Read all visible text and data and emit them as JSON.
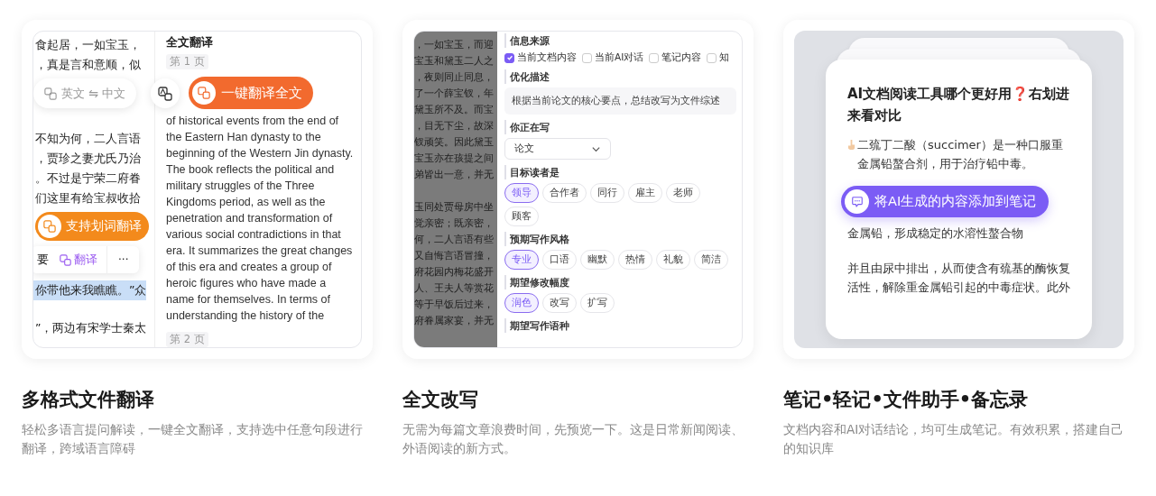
{
  "features": [
    {
      "kind": "translate",
      "title": "多格式文件翻译",
      "description": "轻松多语言提问解读，一键全文翻译，支持选中任意句段进行翻译，跨域语言障碍",
      "demo": {
        "source_lines_top": [
          "食起居，一如宝玉，",
          "，真是言和意顺，似"
        ],
        "language_switch": {
          "from": "英文",
          "arrow": "⇋",
          "to": "中文"
        },
        "translate_all_button": "一键翻译全文",
        "source_lines_middle": [
          "不知为何，二人言语",
          "，贾珍之妻尤氏乃治",
          "。不过是宁荣二府眷",
          "们这里有给宝叔收拾"
        ],
        "selection_badge": "支持划词翻译",
        "selection_toolbar": {
          "label": "要",
          "translate": "翻译",
          "more": "···"
        },
        "highlighted_line": "你带他来我瞧瞧。”众",
        "source_lines_bottom": [
          "”，两边有宋学士秦太"
        ],
        "panel_title": "全文翻译",
        "page_labels": [
          "第 1 页",
          "第 2 页"
        ],
        "translation": "of historical events from the end of the Eastern Han dynasty to the beginning of the Western Jin dynasty. The book reflects the political and military struggles of the Three Kingdoms period, as well as the penetration and transformation of various social contradictions in that era. It summarizes the great changes of this era and creates a group of heroic figures who have made a name for themselves. In terms of understanding the history of the"
      }
    },
    {
      "kind": "rewrite",
      "title": "全文改写",
      "description": "无需为每篇文章浪费时间，先预览一下。这是日常新闻阅读、外语阅读的新方式。",
      "demo": {
        "document_paragraphs": [
          [
            "，一如宝玉，而迎",
            "宝玉和黛玉二人之",
            "，夜则同止同息，",
            "了一个薛宝钗，年",
            "黛玉所不及。而宝",
            "，目无下尘，故深",
            "钗顽笑。因此黛玉",
            "宝玉亦在孩提之间",
            "弟皆出一意，并无"
          ],
          [
            "玉同处贾母房中坐",
            "觉亲密；既亲密，",
            "何，二人言语有些",
            "又自悔言语冒撞，",
            "府花园内梅花盛开",
            "人、王夫人等赏花",
            "等于早饭后过来，",
            "府眷属家宴，并无"
          ]
        ],
        "sections": [
          {
            "kind": "checkboxes",
            "label": "信息来源",
            "options": [
              {
                "label": "当前文档内容",
                "checked": true
              },
              {
                "label": "当前AI对话",
                "checked": false
              },
              {
                "label": "笔记内容",
                "checked": false
              },
              {
                "label": "知",
                "checked": false
              }
            ]
          },
          {
            "kind": "textarea",
            "label": "优化描述",
            "value": "根据当前论文的核心要点，总结改写为文件综述"
          },
          {
            "kind": "select",
            "label": "你正在写",
            "value": "论文"
          },
          {
            "kind": "chips",
            "label": "目标读者是",
            "options": [
              {
                "label": "领导",
                "selected": true
              },
              {
                "label": "合作者",
                "selected": false
              },
              {
                "label": "同行",
                "selected": false
              },
              {
                "label": "雇主",
                "selected": false
              },
              {
                "label": "老师",
                "selected": false
              },
              {
                "label": "顾客",
                "selected": false
              }
            ]
          },
          {
            "kind": "chips",
            "label": "预期写作风格",
            "options": [
              {
                "label": "专业",
                "selected": true
              },
              {
                "label": "口语",
                "selected": false
              },
              {
                "label": "幽默",
                "selected": false
              },
              {
                "label": "热情",
                "selected": false
              },
              {
                "label": "礼貌",
                "selected": false
              },
              {
                "label": "简洁",
                "selected": false
              }
            ]
          },
          {
            "kind": "chips",
            "label": "期望修改幅度",
            "options": [
              {
                "label": "润色",
                "selected": true
              },
              {
                "label": "改写",
                "selected": false
              },
              {
                "label": "扩写",
                "selected": false
              }
            ]
          },
          {
            "kind": "heading",
            "label": "期望写作语种"
          }
        ]
      }
    },
    {
      "kind": "notes",
      "title": "笔记•轻记•文件助手•备忘录",
      "description": "文档内容和AI对话结论，均可生成笔记。有效积累，搭建自己的知识库",
      "demo": {
        "note_title": "AI文档阅读工具哪个更好用❓右划进来看对比",
        "paragraphs": [
          "二巯丁二酸（succimer）是一种口服重金属铅螯合剂，用于治疗铅中毒。",
          "金属铅，形成稳定的水溶性螯合物",
          "并且由尿中排出，从而使含有巯基的酶恢复活性，解除重金属铅引起的中毒症状。此外"
        ],
        "add_to_notes_button": "将AI生成的内容添加到笔记"
      }
    }
  ]
}
